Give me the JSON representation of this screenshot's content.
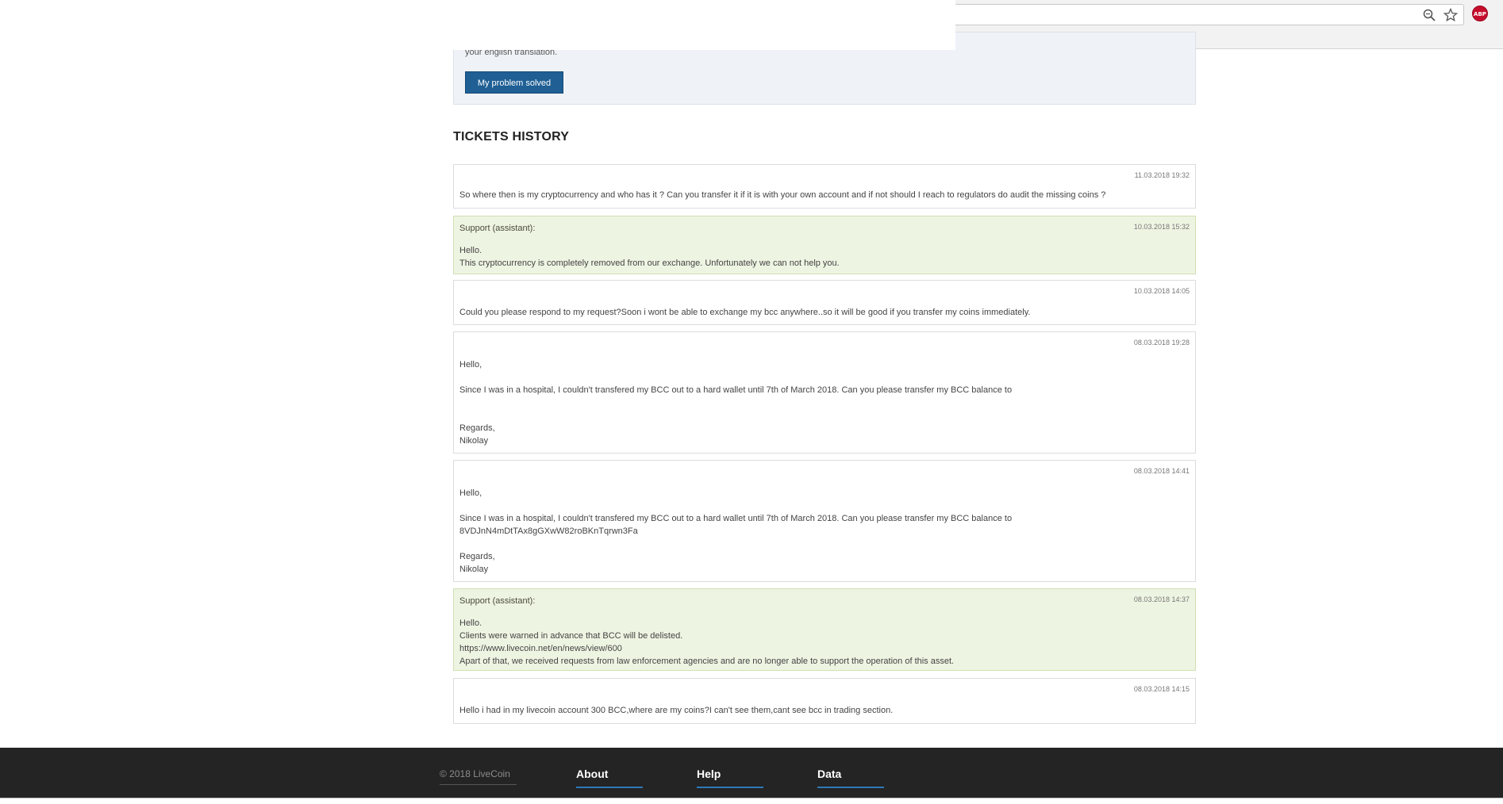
{
  "browser": {
    "zoom_icon": "magnifier-zoom-icon",
    "bookmark_icon": "star-icon",
    "extension_badge": "ABP"
  },
  "hint": {
    "text": "your english translation.",
    "button_label": "My problem solved"
  },
  "history": {
    "title": "TICKETS HISTORY",
    "messages": [
      {
        "type": "user",
        "author": "",
        "date": "11.03.2018 19:32",
        "lines": [
          "So where then is my cryptocurrency and who has it ? Can you transfer it if it is with your own account and if not should I reach to regulators do audit the missing coins ?"
        ]
      },
      {
        "type": "support",
        "author": "Support (assistant):",
        "date": "10.03.2018 15:32",
        "lines": [
          "Hello.",
          "This cryptocurrency is completely removed from our exchange. Unfortunately we can not help you."
        ]
      },
      {
        "type": "user",
        "author": "",
        "date": "10.03.2018 14:05",
        "lines": [
          "Could you please respond to my request?Soon i wont be able to exchange my bcc anywhere..so it will be good if you transfer my coins immediately."
        ]
      },
      {
        "type": "user",
        "author": "",
        "date": "08.03.2018 19:28",
        "lines": [
          "Hello,",
          "",
          "Since I was in a hospital, I couldn't transfered my BCC out to a hard wallet until 7th of March 2018. Can you please transfer my BCC balance to",
          "",
          "",
          "Regards,",
          "Nikolay"
        ]
      },
      {
        "type": "user",
        "author": "",
        "date": "08.03.2018 14:41",
        "lines": [
          "Hello,",
          "",
          "Since I was in a hospital, I couldn't transfered my BCC out to a hard wallet until 7th of March 2018. Can you please transfer my BCC balance to",
          "8VDJnN4mDtTAx8gGXwW82roBKnTqrwn3Fa",
          "",
          "Regards,",
          "Nikolay"
        ]
      },
      {
        "type": "support",
        "author": "Support (assistant):",
        "date": "08.03.2018 14:37",
        "lines": [
          "Hello.",
          "Clients were warned in advance that BCC will be delisted.",
          "https://www.livecoin.net/en/news/view/600",
          "Apart of that, we received requests from law enforcement agencies and are no longer able to support the operation of this asset."
        ]
      },
      {
        "type": "user",
        "author": "",
        "date": "08.03.2018 14:15",
        "lines": [
          "Hello i had in my livecoin account 300 BCC,where are my coins?I can't see them,cant see bcc in trading section."
        ]
      }
    ]
  },
  "footer": {
    "copyright": "© 2018 LiveCoin",
    "links": [
      "About",
      "Help",
      "Data"
    ]
  },
  "colors": {
    "button": "#1f5f94",
    "support_bg": "#eef4e2",
    "footer_bg": "#242424",
    "footer_underline": "#2e78b6"
  }
}
